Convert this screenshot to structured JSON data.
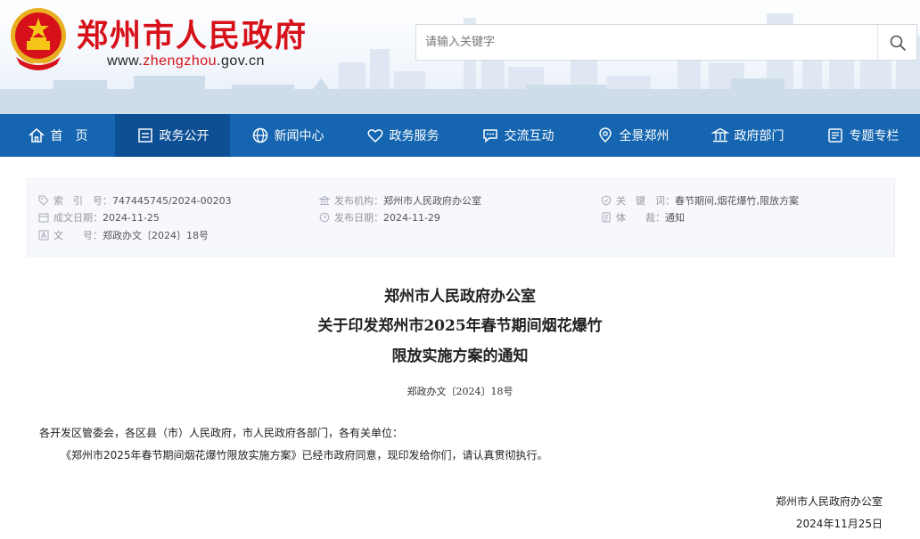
{
  "header": {
    "site_title": "郑州市人民政府",
    "url_prefix": "www.",
    "url_brand": "zhengzhou",
    "url_suffix": ".gov.cn",
    "search_placeholder": "请输入关键字"
  },
  "nav": {
    "items": [
      {
        "label": "首　页",
        "icon": "home-icon"
      },
      {
        "label": "政务公开",
        "icon": "document-icon",
        "active": true
      },
      {
        "label": "新闻中心",
        "icon": "globe-icon"
      },
      {
        "label": "政务服务",
        "icon": "heart-icon"
      },
      {
        "label": "交流互动",
        "icon": "chat-icon"
      },
      {
        "label": "全景郑州",
        "icon": "map-pin-icon"
      },
      {
        "label": "政府部门",
        "icon": "building-icon"
      },
      {
        "label": "专题专栏",
        "icon": "list-icon"
      }
    ]
  },
  "meta": {
    "index_key": "索　引　号：",
    "index_val": "747445745/2024-00203",
    "created_key": "成文日期：",
    "created_val": "2024-11-25",
    "docno_key": "文　　号：",
    "docno_val": "郑政办文〔2024〕18号",
    "issuer_key": "发布机构：",
    "issuer_val": "郑州市人民政府办公室",
    "published_key": "发布日期：",
    "published_val": "2024-11-29",
    "keywords_key": "关　键　词：",
    "keywords_val": "春节期间,烟花爆竹,限放方案",
    "genre_key": "体　　裁：",
    "genre_val": "通知"
  },
  "document": {
    "title_line1": "郑州市人民政府办公室",
    "title_line2": "关于印发郑州市2025年春节期间烟花爆竹",
    "title_line3": "限放实施方案的通知",
    "doc_number": "郑政办文〔2024〕18号",
    "salutation": "各开发区管委会，各区县（市）人民政府，市人民政府各部门，各有关单位：",
    "body": "《郑州市2025年春节期间烟花爆竹限放实施方案》已经市政府同意，现印发给你们，请认真贯彻执行。",
    "signature": "郑州市人民政府办公室",
    "date": "2024年11月25日"
  },
  "colors": {
    "brand_red": "#d7111a",
    "nav_blue": "#1565b0",
    "nav_active": "#0d4f95"
  }
}
